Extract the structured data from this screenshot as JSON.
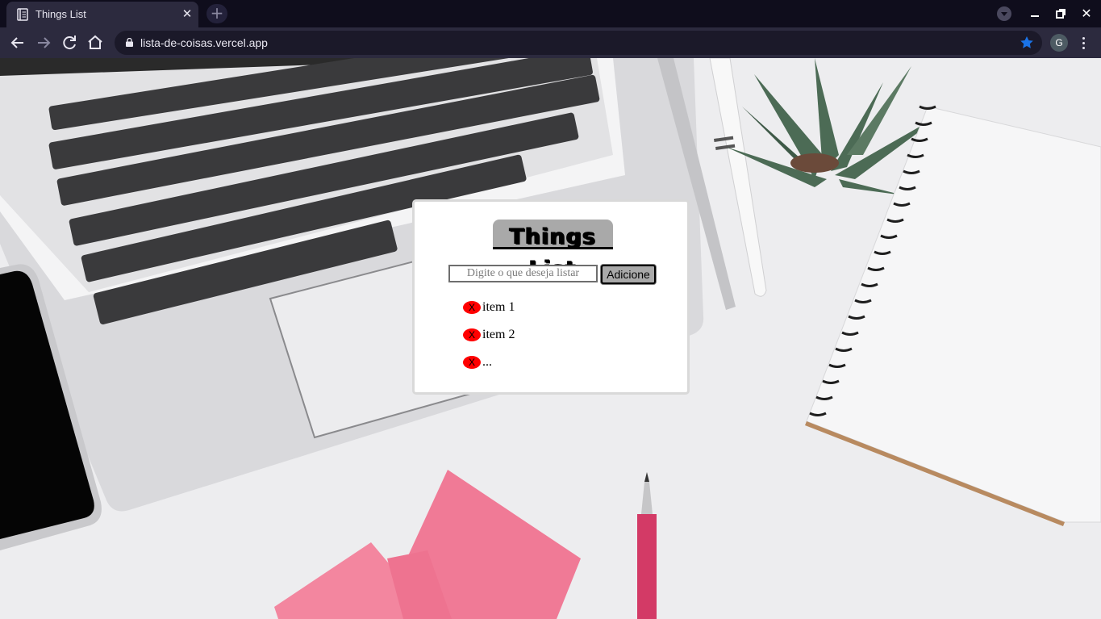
{
  "browser": {
    "tab_title": "Things List",
    "url": "lista-de-coisas.vercel.app",
    "profile_initial": "G",
    "star_color": "#1a73e8"
  },
  "app": {
    "title": "Things List",
    "input_placeholder": "Digite o que deseja listar",
    "add_button_label": "Adicione",
    "remove_label": "X",
    "items": [
      "item 1",
      "item 2",
      "..."
    ]
  },
  "colors": {
    "remove_button": "#ff0000",
    "title_background": "#a9a9a9",
    "sticky_notes": "#f07a96",
    "pen": "#d33a66"
  }
}
